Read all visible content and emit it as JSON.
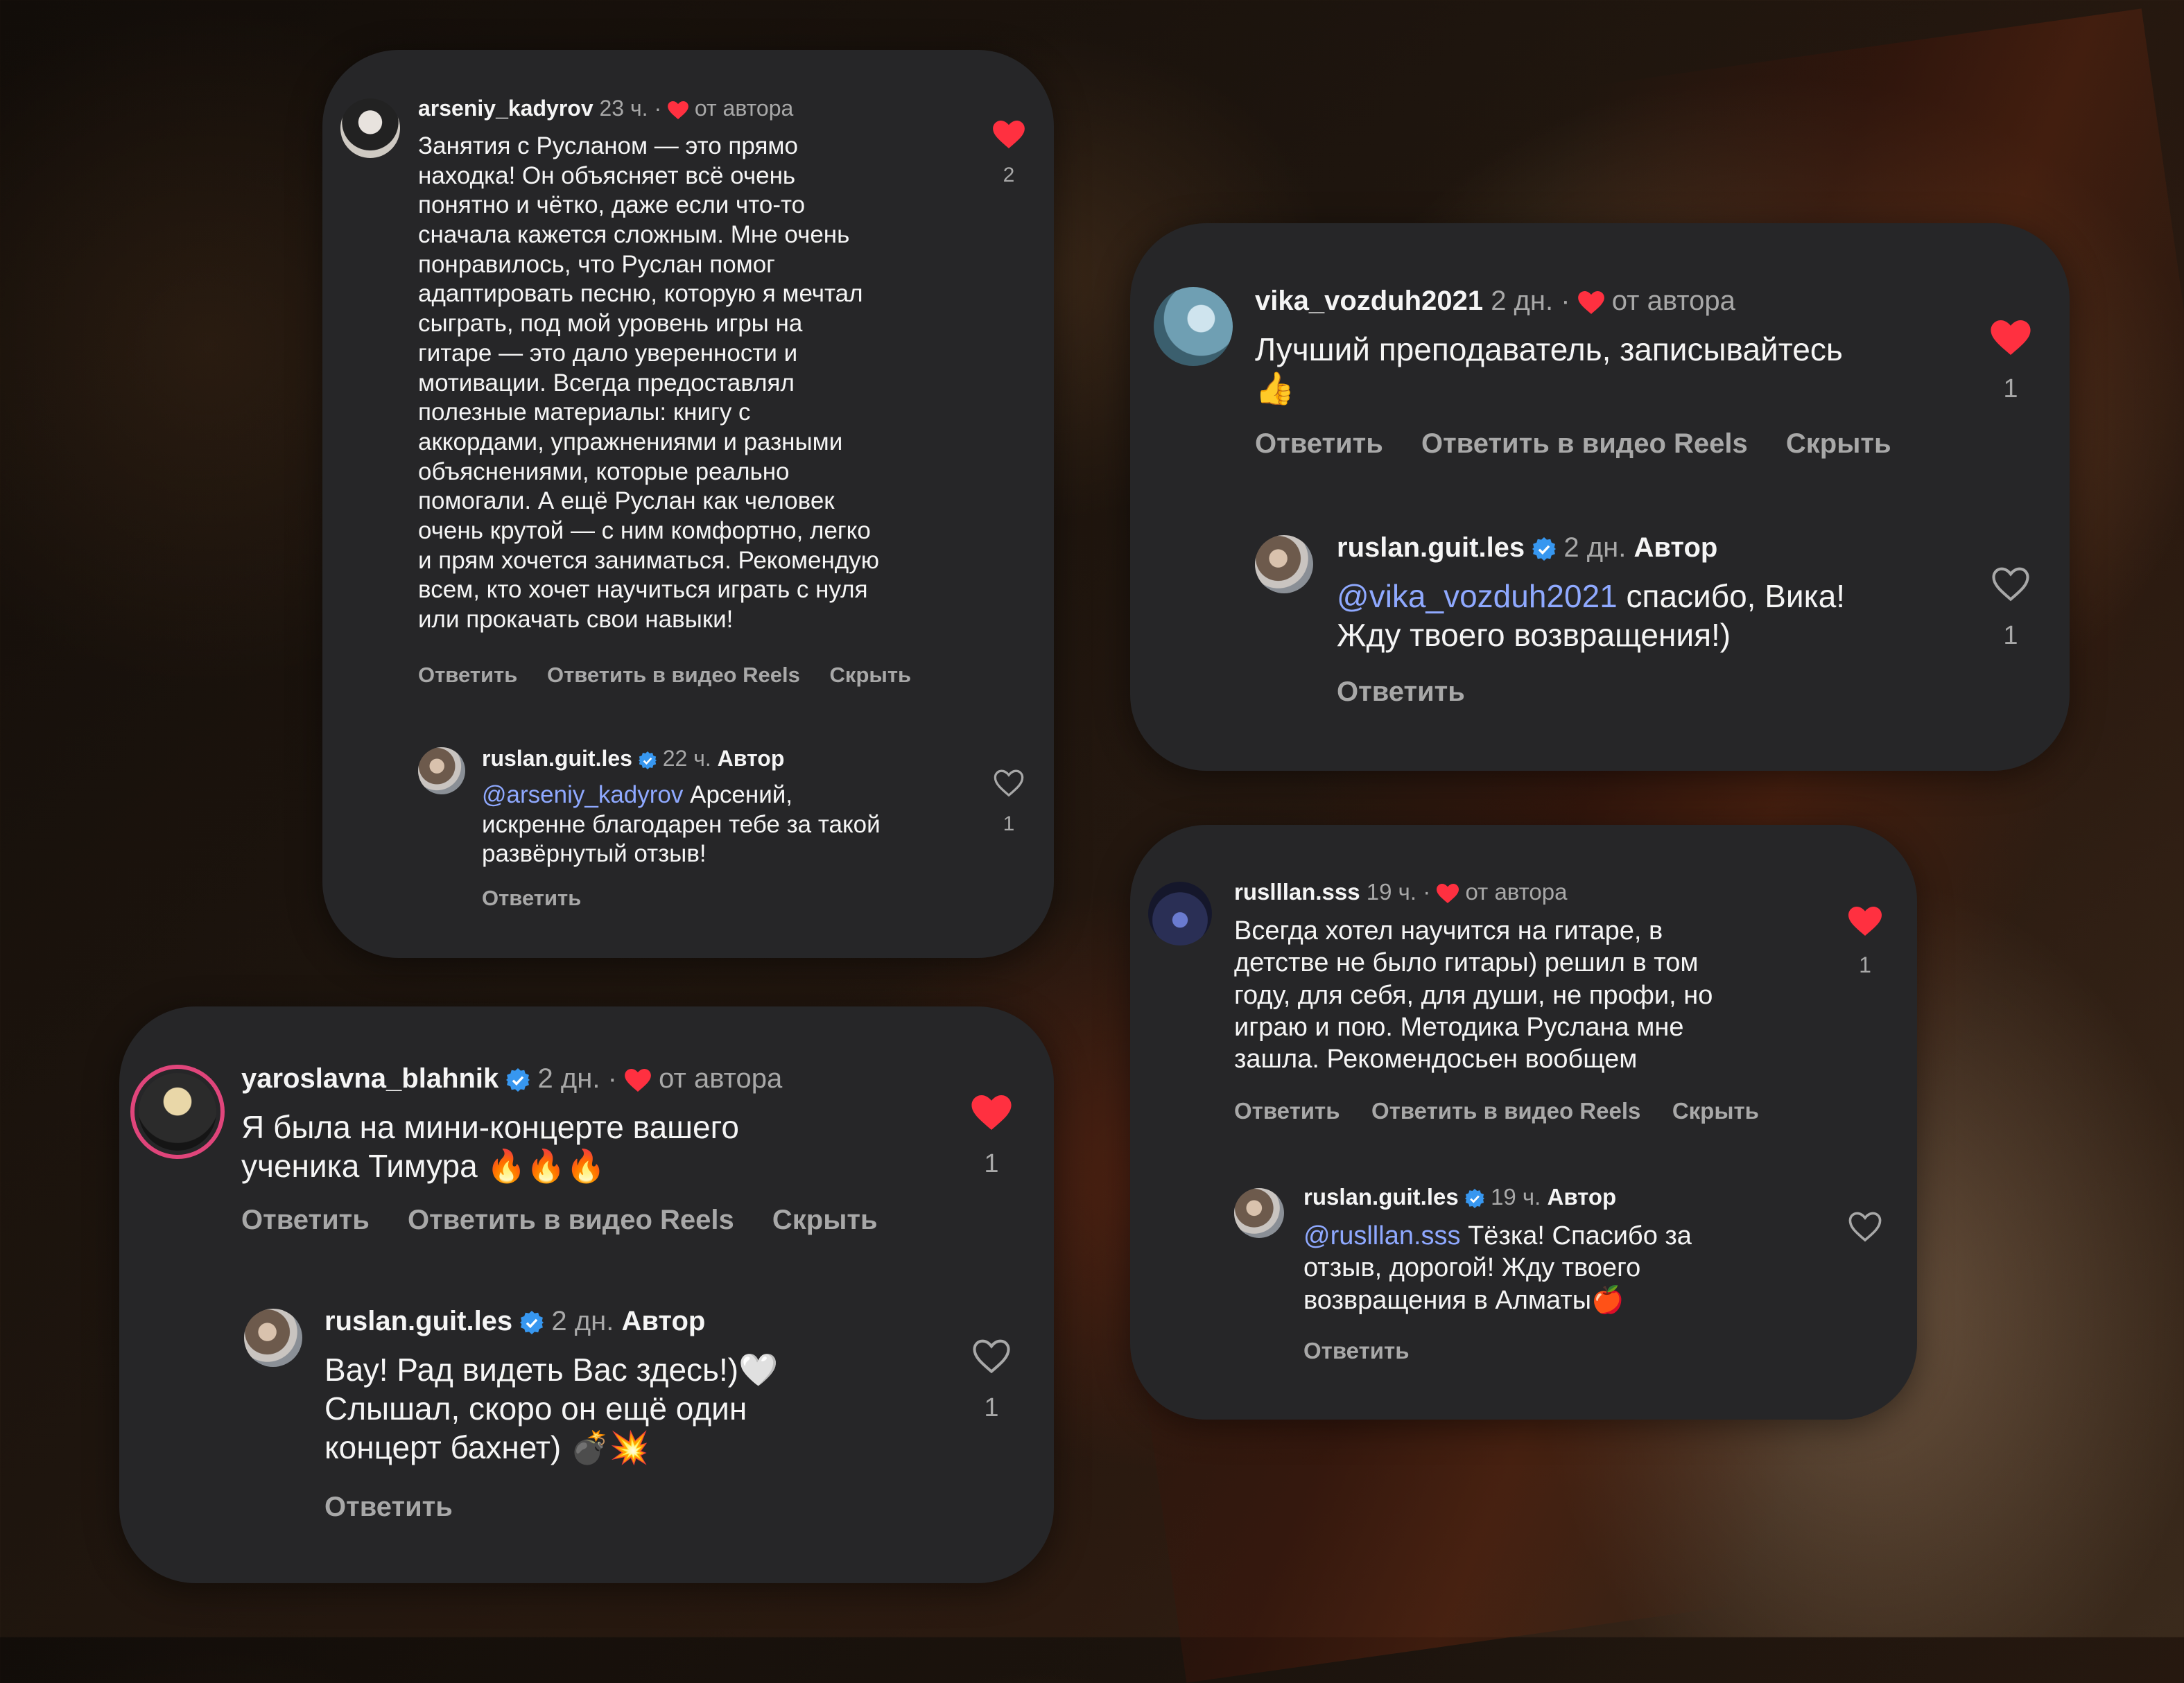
{
  "comments": [
    {
      "username": "arseniy_kadyrov",
      "time": "23 ч.",
      "liked_by_author": "от автора",
      "lines": [
        "Занятия с Русланом — это прямо",
        "находка! Он объясняет всё очень",
        "понятно и чётко, даже если что-то",
        "сначала кажется сложным. Мне очень",
        "понравилось, что Руслан помог",
        "адаптировать песню, которую я мечтал",
        "сыграть, под мой уровень игры на",
        "гитаре — это дало уверенности и",
        "мотивации. Всегда предоставлял",
        "полезные материалы: книгу с",
        "аккордами, упражнениями и разными",
        "объяснениями, которые реально",
        "помогали. А ещё Руслан как человек",
        "очень крутой — с ним комфортно, легко",
        "и прям хочется заниматься. Рекомендую",
        "всем, кто хочет научиться играть с нуля",
        "или прокачать свои навыки!"
      ],
      "likes": "2",
      "actions": [
        "Ответить",
        "Ответить в видео Reels",
        "Скрыть"
      ],
      "reply": {
        "username": "ruslan.guit.les",
        "time": "22 ч.",
        "author_label": "Автор",
        "mention": "@arseniy_kadyrov",
        "lines": [
          " Арсений,",
          "искренне благодарен тебе за такой",
          "развёрнутый отзыв!"
        ],
        "likes": "1",
        "action": "Ответить"
      }
    },
    {
      "username": "vika_vozduh2021",
      "time": "2 дн.",
      "liked_by_author": "от автора",
      "lines": [
        "Лучший преподаватель, записывайтесь",
        "👍"
      ],
      "likes": "1",
      "actions": [
        "Ответить",
        "Ответить в видео Reels",
        "Скрыть"
      ],
      "reply": {
        "username": "ruslan.guit.les",
        "time": "2 дн.",
        "author_label": "Автор",
        "mention": "@vika_vozduh2021",
        "lines": [
          " спасибо, Вика!",
          "Жду твоего возвращения!)"
        ],
        "likes": "1",
        "action": "Ответить"
      }
    },
    {
      "username": "ruslllan.sss",
      "time": "19 ч.",
      "liked_by_author": "от автора",
      "lines": [
        "Всегда хотел научится на гитаре, в",
        "детстве не было гитары) решил в том",
        "году, для себя, для души, не профи, но",
        "играю и пою. Методика Руслана мне",
        "зашла. Рекомендосьен вообщем"
      ],
      "likes": "1",
      "actions": [
        "Ответить",
        "Ответить в видео Reels",
        "Скрыть"
      ],
      "reply": {
        "username": "ruslan.guit.les",
        "time": "19 ч.",
        "author_label": "Автор",
        "mention": "@ruslllan.sss",
        "lines": [
          " Тёзка! Спасибо за",
          "отзыв, дорогой! Жду твоего",
          "возвращения в Алматы🍎"
        ],
        "likes": "",
        "action": "Ответить"
      }
    },
    {
      "username": "yaroslavna_blahnik",
      "time": "2 дн.",
      "liked_by_author": "от автора",
      "lines": [
        "Я была на мини-концерте вашего",
        "ученика Тимура 🔥🔥🔥"
      ],
      "likes": "1",
      "actions": [
        "Ответить",
        "Ответить в видео Reels",
        "Скрыть"
      ],
      "reply": {
        "username": "ruslan.guit.les",
        "time": "2 дн.",
        "author_label": "Автор",
        "mention": "",
        "lines": [
          "Вау! Рад видеть Вас здесь!)🤍",
          "Слышал, скоро он ещё один",
          "концерт бахнет) 💣💥"
        ],
        "likes": "1",
        "action": "Ответить"
      }
    }
  ],
  "colors": {
    "card": "#262628",
    "heart_red": "#ff3040",
    "verified_blue": "#3797f0",
    "mention": "#8fa9ff",
    "muted": "#a8a8a8"
  },
  "icons": [
    "heart-filled-icon",
    "heart-outline-icon",
    "verified-badge-icon",
    "avatar"
  ]
}
